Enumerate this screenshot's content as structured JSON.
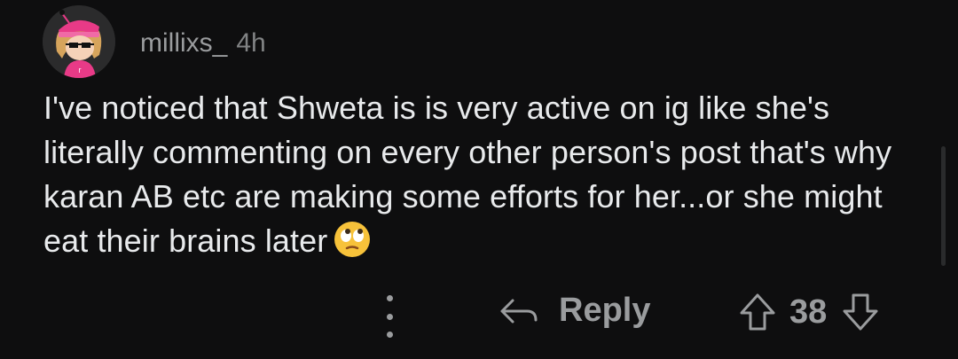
{
  "comment": {
    "author": "millixs_",
    "age": "4h",
    "text": "I've noticed that Shweta is is very active on ig like she's literally commenting on every other person's post that's why karan AB etc are making some efforts for her...or she might eat their brains later",
    "emoji": "face-with-rolling-eyes"
  },
  "actions": {
    "reply_label": "Reply",
    "vote_count": "38"
  },
  "colors": {
    "background": "#0e0e0f",
    "text": "#e8eaec",
    "muted": "#9a9c9e",
    "avatar_accent": "#e83a87"
  }
}
